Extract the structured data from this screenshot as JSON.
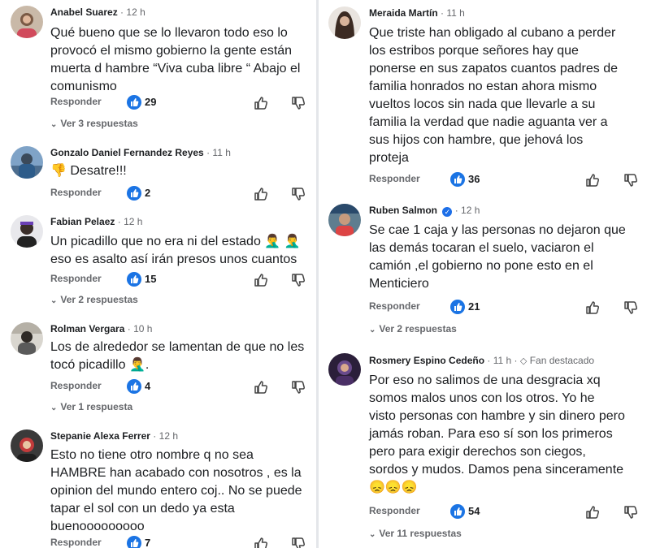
{
  "left": {
    "comments": [
      {
        "author": "Anabel Suarez",
        "time": "12 h",
        "lines": [
          "Qué bueno que se lo llevaron todo eso lo",
          "provocó el mismo gobierno la gente están",
          "muerta d hambre “Viva cuba libre “ Abajo el",
          "comunismo"
        ],
        "reply": "Responder",
        "likes": "29",
        "replies": "Ver 3 respuestas"
      },
      {
        "author": "Gonzalo Daniel Fernandez Reyes",
        "time": "11 h",
        "lines": [
          "👎 Desatre!!!"
        ],
        "reply": "Responder",
        "likes": "2",
        "replies": ""
      },
      {
        "author": "Fabian Pelaez",
        "time": "12 h",
        "lines": [
          "Un picadillo que no era ni del estado 🤦‍♂️ 🤦‍♂️",
          "eso es asalto así irán presos unos cuantos"
        ],
        "reply": "Responder",
        "likes": "15",
        "replies": "Ver 2 respuestas"
      },
      {
        "author": "Rolman Vergara",
        "time": "10 h",
        "lines": [
          "Los de alrededor se lamentan de que no les",
          "tocó picadillo 🤦‍♂️."
        ],
        "reply": "Responder",
        "likes": "4",
        "replies": "Ver 1 respuesta"
      },
      {
        "author": "Stepanie Alexa Ferrer",
        "time": "12 h",
        "lines": [
          "Esto no tiene otro nombre q no sea",
          "HAMBRE han acabado con nosotros , es la",
          "opinion del mundo entero coj.. No se puede",
          "tapar el sol con un dedo ya esta",
          "buenooooooooo"
        ],
        "reply": "Responder",
        "likes": "7",
        "replies": ""
      }
    ]
  },
  "right": {
    "comments": [
      {
        "author": "Meraida Martín",
        "time": "11 h",
        "lines": [
          "Que triste han obligado al cubano a perder",
          "los estribos porque señores hay que",
          "ponerse en sus zapatos cuantos padres de",
          "familia honrados no estan ahora mismo",
          "vueltos locos sin nada que llevarle a su",
          "familia la verdad que nadie aguanta ver a",
          "sus hijos con hambre, que jehová los",
          "proteja"
        ],
        "reply": "Responder",
        "likes": "36",
        "replies": ""
      },
      {
        "author": "Ruben Salmon",
        "time": "12 h",
        "verified": true,
        "lines": [
          "Se cae 1 caja y las personas no dejaron que",
          "las demás tocaran el suelo, vaciaron el",
          "camión ,el gobierno no pone esto en el",
          "Menticiero"
        ],
        "reply": "Responder",
        "likes": "21",
        "replies": "Ver 2 respuestas"
      },
      {
        "author": "Rosmery Espino Cedeño",
        "time": "11 h",
        "badge": "Fan destacado",
        "lines": [
          "Por eso no salimos de una desgracia xq",
          "somos malos unos con los otros. Yo he",
          "visto personas con hambre y sin dinero pero",
          "jamás roban. Para eso sí son los primeros",
          "pero para exigir derechos son ciegos,",
          "sordos y mudos. Damos pena sinceramente",
          "😞😞😞"
        ],
        "reply": "Responder",
        "likes": "54",
        "replies": "Ver 11 respuestas"
      }
    ]
  },
  "colors": {
    "like_blue": "#1b74e4",
    "secondary_text": "#65676b",
    "verified": "#1d6fe8"
  },
  "icons": {
    "like_badge": "thumbs-up-icon",
    "like_action": "like-outline-icon",
    "dislike_action": "dislike-outline-icon",
    "replies_toggle": "chevron-down-icon",
    "fan_badge": "diamond-icon"
  }
}
